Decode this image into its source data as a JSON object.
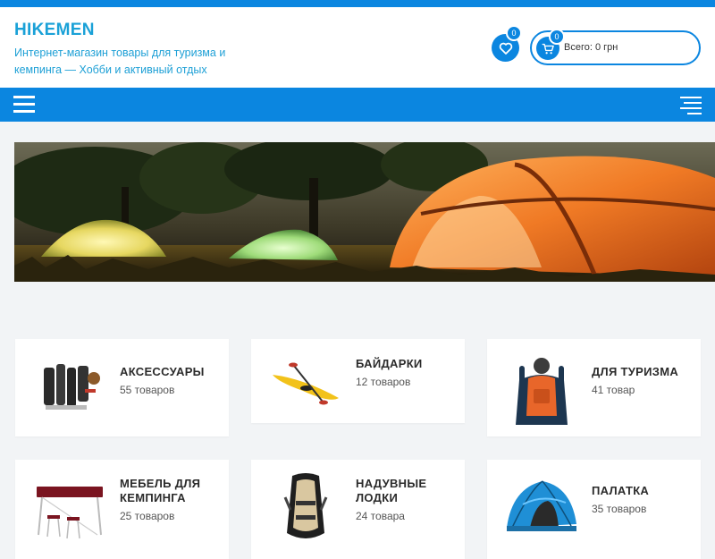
{
  "site": {
    "title": "HIKEMEN",
    "tagline": "Интернет-магазин товары для туризма и кемпинга — Хобби и активный отдых"
  },
  "header": {
    "wishlist_count": "0",
    "cart_count": "0",
    "cart_total": "Всего: 0 грн"
  },
  "icons": {
    "wishlist": "heart-icon",
    "cart": "cart-icon",
    "menu": "hamburger-menu-icon",
    "menu_alt": "secondary-menu-icon"
  },
  "colors": {
    "accent": "#0b86e0",
    "title": "#1aa1d7",
    "background": "#f2f4f6"
  },
  "banner": {
    "subject": "camping tents at dusk"
  },
  "categories": [
    {
      "name": "АКСЕССУАРЫ",
      "count": "55 товаров"
    },
    {
      "name": "БАЙДАРКИ",
      "count": "12 товаров"
    },
    {
      "name": "ДЛЯ ТУРИЗМА",
      "count": "41 товар"
    },
    {
      "name": "МЕБЕЛЬ ДЛЯ КЕМПИНГА",
      "count": "25 товаров"
    },
    {
      "name": "НАДУВНЫЕ ЛОДКИ",
      "count": "24 товара"
    },
    {
      "name": "ПАЛАТКА",
      "count": "35 товаров"
    }
  ]
}
